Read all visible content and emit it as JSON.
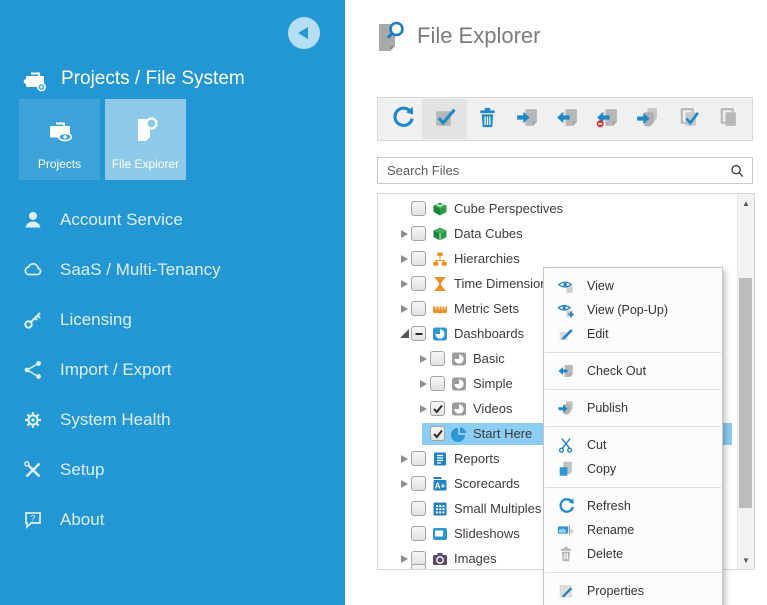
{
  "colors": {
    "sidebar_blue": "#2397d3",
    "tile_blue": "#3da3d8",
    "tile_active_blue": "#8fc9ea",
    "accent_blue": "#1e88c8",
    "selection_blue": "#8bcdf3",
    "title_gray": "#7b7b7b"
  },
  "sidebar": {
    "back_button": {
      "icon": "back-arrow-icon"
    },
    "header": {
      "icon": "puzzle-briefcase-icon",
      "label": "Projects / File System"
    },
    "tiles": [
      {
        "label": "Projects",
        "icon": "projects-briefcase-icon",
        "active": false
      },
      {
        "label": "File Explorer",
        "icon": "file-search-icon",
        "active": true
      }
    ],
    "nav": [
      {
        "label": "Account Service",
        "icon": "person-icon"
      },
      {
        "label": "SaaS / Multi-Tenancy",
        "icon": "cloud-icon"
      },
      {
        "label": "Licensing",
        "icon": "key-icon"
      },
      {
        "label": "Import / Export",
        "icon": "share-icon"
      },
      {
        "label": "System Health",
        "icon": "gear-icon"
      },
      {
        "label": "Setup",
        "icon": "tools-icon"
      },
      {
        "label": "About",
        "icon": "chat-question-icon"
      }
    ]
  },
  "main": {
    "title": {
      "label": "File Explorer",
      "icon": "file-search-doc-icon"
    },
    "toolbar": [
      {
        "name": "refresh",
        "icon": "refresh-icon",
        "active": false
      },
      {
        "name": "multi-select",
        "icon": "checkbox-checked-icon",
        "active": true
      },
      {
        "name": "delete",
        "icon": "trash-icon",
        "active": false
      },
      {
        "name": "check-in",
        "icon": "checkin-doc-icon",
        "active": false
      },
      {
        "name": "check-out",
        "icon": "checkout-doc-icon",
        "active": false
      },
      {
        "name": "undo-check-out",
        "icon": "undo-checkout-icon",
        "active": false
      },
      {
        "name": "publish",
        "icon": "publish-docs-icon",
        "active": false
      },
      {
        "name": "select-all",
        "icon": "multi-check-icon",
        "active": false
      },
      {
        "name": "copy-all",
        "icon": "multi-copy-icon",
        "active": false
      }
    ],
    "search": {
      "placeholder": "Search Files",
      "icon": "search-icon"
    },
    "tree": [
      {
        "label": "Cube Perspectives",
        "level": 0,
        "expander": "none",
        "checkbox": "unchecked",
        "icon": "open-cube-icon",
        "selected": false
      },
      {
        "label": "Data Cubes",
        "level": 0,
        "expander": "collapsed",
        "checkbox": "unchecked",
        "icon": "cube-icon",
        "selected": false
      },
      {
        "label": "Hierarchies",
        "level": 0,
        "expander": "collapsed",
        "checkbox": "unchecked",
        "icon": "hierarchy-icon",
        "selected": false
      },
      {
        "label": "Time Dimensions",
        "level": 0,
        "expander": "collapsed",
        "checkbox": "unchecked",
        "icon": "hourglass-icon",
        "selected": false
      },
      {
        "label": "Metric Sets",
        "level": 0,
        "expander": "collapsed",
        "checkbox": "unchecked",
        "icon": "ruler-icon",
        "selected": false
      },
      {
        "label": "Dashboards",
        "level": 0,
        "expander": "expanded",
        "checkbox": "indeterminate",
        "icon": "dashboard-blue-icon",
        "selected": false
      },
      {
        "label": "Basic",
        "level": 1,
        "expander": "collapsed",
        "checkbox": "unchecked",
        "icon": "dashboard-gray-icon",
        "selected": false
      },
      {
        "label": "Simple",
        "level": 1,
        "expander": "collapsed",
        "checkbox": "unchecked",
        "icon": "dashboard-gray-icon",
        "selected": false
      },
      {
        "label": "Videos",
        "level": 1,
        "expander": "collapsed",
        "checkbox": "checked",
        "icon": "dashboard-gray-icon",
        "selected": false
      },
      {
        "label": "Start Here",
        "level": 1,
        "expander": "none",
        "checkbox": "checked",
        "icon": "pie-chart-icon",
        "selected": true
      },
      {
        "label": "Reports",
        "level": 0,
        "expander": "collapsed",
        "checkbox": "unchecked",
        "icon": "report-icon",
        "selected": false
      },
      {
        "label": "Scorecards",
        "level": 0,
        "expander": "collapsed",
        "checkbox": "unchecked",
        "icon": "scorecard-icon",
        "selected": false
      },
      {
        "label": "Small Multiples",
        "level": 0,
        "expander": "none",
        "checkbox": "unchecked",
        "icon": "grid-icon",
        "selected": false
      },
      {
        "label": "Slideshows",
        "level": 0,
        "expander": "none",
        "checkbox": "unchecked",
        "icon": "slideshow-icon",
        "selected": false
      },
      {
        "label": "Images",
        "level": 0,
        "expander": "collapsed",
        "checkbox": "unchecked",
        "icon": "camera-icon",
        "selected": false
      }
    ],
    "scrollbar": {
      "up_arrow": "▲",
      "down_arrow": "▼"
    }
  },
  "context_menu": {
    "groups": [
      [
        {
          "label": "View",
          "icon": "view-eye-icon"
        },
        {
          "label": "View (Pop-Up)",
          "icon": "view-popup-icon"
        },
        {
          "label": "Edit",
          "icon": "edit-pencil-icon"
        }
      ],
      [
        {
          "label": "Check Out",
          "icon": "checkout-doc-icon"
        }
      ],
      [
        {
          "label": "Publish",
          "icon": "publish-docs-icon"
        }
      ],
      [
        {
          "label": "Cut",
          "icon": "cut-scissors-icon"
        },
        {
          "label": "Copy",
          "icon": "copy-icon"
        }
      ],
      [
        {
          "label": "Refresh",
          "icon": "refresh-icon"
        },
        {
          "label": "Rename",
          "icon": "rename-icon"
        },
        {
          "label": "Delete",
          "icon": "delete-trash-icon"
        }
      ],
      [
        {
          "label": "Properties",
          "icon": "properties-icon"
        }
      ]
    ]
  }
}
